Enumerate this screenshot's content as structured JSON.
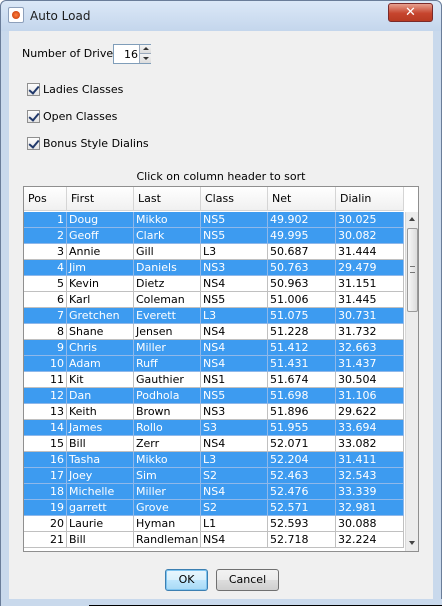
{
  "window": {
    "title": "Auto Load",
    "close_glyph": "✕"
  },
  "drivers": {
    "label": "Number of Drivers",
    "value": "16"
  },
  "options": [
    {
      "label": "Ladies Classes",
      "checked": true
    },
    {
      "label": "Open Classes",
      "checked": true
    },
    {
      "label": "Bonus Style Dialins",
      "checked": true
    }
  ],
  "sort_hint": "Click on column header to sort",
  "table": {
    "columns": [
      "Pos",
      "First",
      "Last",
      "Class",
      "Net",
      "Dialin"
    ],
    "rows": [
      {
        "cells": [
          "1",
          "Doug",
          "Mikko",
          "NS5",
          "49.902",
          "30.025"
        ],
        "selected": true
      },
      {
        "cells": [
          "2",
          "Geoff",
          "Clark",
          "NS5",
          "49.995",
          "30.082"
        ],
        "selected": true
      },
      {
        "cells": [
          "3",
          "Annie",
          "Gill",
          "L3",
          "50.687",
          "31.444"
        ],
        "selected": false
      },
      {
        "cells": [
          "4",
          "Jim",
          "Daniels",
          "NS3",
          "50.763",
          "29.479"
        ],
        "selected": true
      },
      {
        "cells": [
          "5",
          "Kevin",
          "Dietz",
          "NS4",
          "50.963",
          "31.151"
        ],
        "selected": false
      },
      {
        "cells": [
          "6",
          "Karl",
          "Coleman",
          "NS5",
          "51.006",
          "31.445"
        ],
        "selected": false
      },
      {
        "cells": [
          "7",
          "Gretchen",
          "Everett",
          "L3",
          "51.075",
          "30.731"
        ],
        "selected": true
      },
      {
        "cells": [
          "8",
          "Shane",
          "Jensen",
          "NS4",
          "51.228",
          "31.732"
        ],
        "selected": false
      },
      {
        "cells": [
          "9",
          "Chris",
          "Miller",
          "NS4",
          "51.412",
          "32.663"
        ],
        "selected": true
      },
      {
        "cells": [
          "10",
          "Adam",
          "Ruff",
          "NS4",
          "51.431",
          "31.437"
        ],
        "selected": true
      },
      {
        "cells": [
          "11",
          "Kit",
          "Gauthier",
          "NS1",
          "51.674",
          "30.504"
        ],
        "selected": false
      },
      {
        "cells": [
          "12",
          "Dan",
          "Podhola",
          "NS5",
          "51.698",
          "31.106"
        ],
        "selected": true
      },
      {
        "cells": [
          "13",
          "Keith",
          "Brown",
          "NS3",
          "51.896",
          "29.622"
        ],
        "selected": false
      },
      {
        "cells": [
          "14",
          "James",
          "Rollo",
          "S3",
          "51.955",
          "33.694"
        ],
        "selected": true
      },
      {
        "cells": [
          "15",
          "Bill",
          "Zerr",
          "NS4",
          "52.071",
          "33.082"
        ],
        "selected": false
      },
      {
        "cells": [
          "16",
          "Tasha",
          "Mikko",
          "L3",
          "52.204",
          "31.411"
        ],
        "selected": true
      },
      {
        "cells": [
          "17",
          "Joey",
          "Sim",
          "S2",
          "52.463",
          "32.543"
        ],
        "selected": true
      },
      {
        "cells": [
          "18",
          "Michelle",
          "Miller",
          "NS4",
          "52.476",
          "33.339"
        ],
        "selected": true
      },
      {
        "cells": [
          "19",
          "garrett",
          "Grove",
          "S2",
          "52.571",
          "32.981"
        ],
        "selected": true
      },
      {
        "cells": [
          "20",
          "Laurie",
          "Hyman",
          "L1",
          "52.593",
          "30.088"
        ],
        "selected": false
      },
      {
        "cells": [
          "21",
          "Bill",
          "Randleman",
          "NS4",
          "52.718",
          "32.224"
        ],
        "selected": false
      }
    ]
  },
  "buttons": {
    "ok": "OK",
    "cancel": "Cancel"
  },
  "colors": {
    "selection": "#3d9bf0",
    "window_frame": "#c9d9ec",
    "dialog_bg": "#f0f0f0"
  }
}
